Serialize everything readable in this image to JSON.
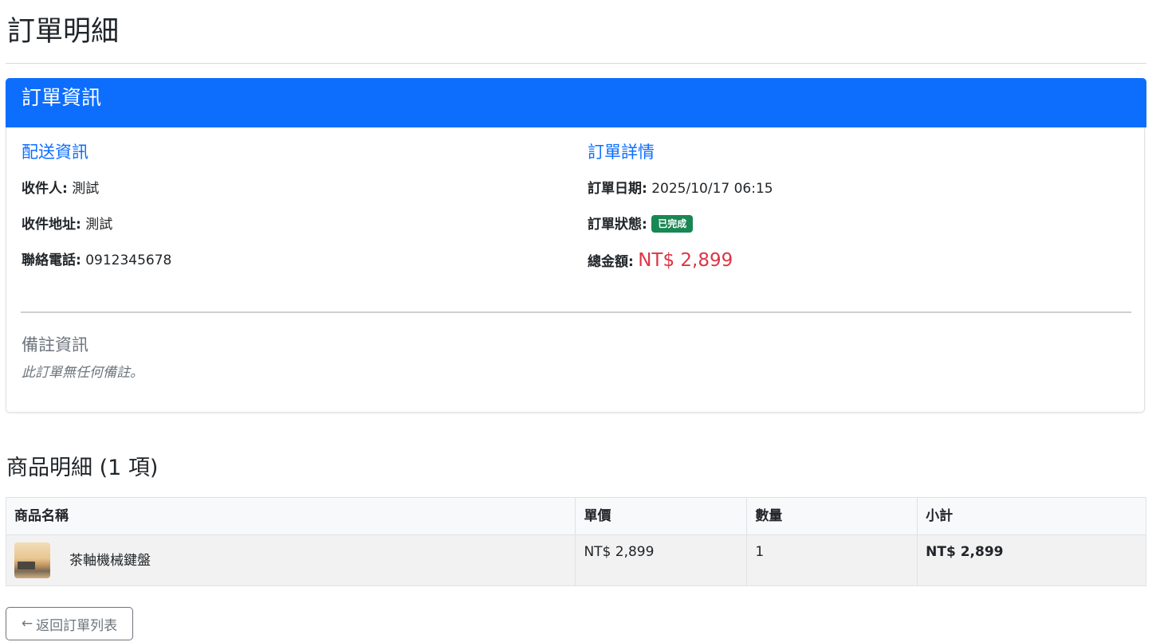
{
  "page": {
    "title": "訂單明細"
  },
  "order_card": {
    "header_title": "訂單資訊",
    "shipping": {
      "heading": "配送資訊",
      "recipient_label": "收件人:",
      "recipient_value": "測試",
      "address_label": "收件地址:",
      "address_value": "測試",
      "phone_label": "聯絡電話:",
      "phone_value": "0912345678"
    },
    "details": {
      "heading": "訂單詳情",
      "date_label": "訂單日期:",
      "date_value": "2025/10/17 06:15",
      "status_label": "訂單狀態:",
      "status_badge": "已完成",
      "total_label": "總金額:",
      "total_value": "NT$ 2,899"
    },
    "notes": {
      "heading": "備註資訊",
      "text": "此訂單無任何備註。"
    }
  },
  "items": {
    "heading": "商品明細 (1 項)",
    "columns": [
      "商品名稱",
      "單價",
      "數量",
      "小計"
    ],
    "rows": [
      {
        "name": "茶軸機械鍵盤",
        "unit_price": "NT$ 2,899",
        "quantity": "1",
        "subtotal": "NT$ 2,899"
      }
    ]
  },
  "actions": {
    "back_arrow": "←",
    "back_label": "返回訂單列表"
  },
  "colors": {
    "primary": "#0d6efd",
    "success": "#198754",
    "danger": "#dc3545",
    "secondary": "#6c757d"
  }
}
